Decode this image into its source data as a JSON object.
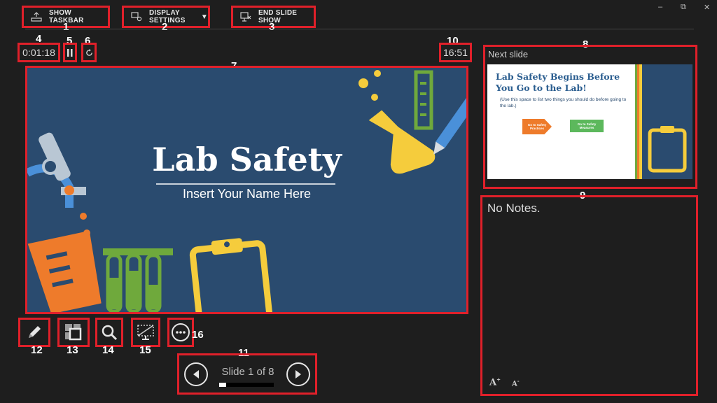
{
  "toolbar": {
    "show_taskbar": "SHOW TASKBAR",
    "display_settings": "DISPLAY SETTINGS",
    "end_slide_show": "END SLIDE SHOW"
  },
  "window_controls": {
    "minimize": "–",
    "restore": "⧉",
    "close": "✕"
  },
  "timer": {
    "elapsed": "0:01:18",
    "pause_icon": "pause-icon",
    "reset_icon": "reset-icon"
  },
  "clock": "16:51",
  "current_slide": {
    "title": "Lab Safety",
    "subtitle": "Insert Your Name Here"
  },
  "next_slide": {
    "label": "Next slide",
    "title": "Lab Safety Begins Before You Go to the Lab!",
    "bullet": "(Use this space to list two things you should do before going to the lab.)",
    "button1": "Go to Safety Practices",
    "button2": "Go to Safety Measures"
  },
  "notes": {
    "text": "No Notes.",
    "increase_font": "A",
    "decrease_font": "A"
  },
  "navigation": {
    "slide_counter": "Slide 1 of 8",
    "progress": 0.125
  },
  "tools": [
    "pen-tool",
    "see-all-slides",
    "zoom",
    "black-screen",
    "more-options"
  ],
  "annotations": [
    "1",
    "2",
    "3",
    "4",
    "5",
    "6",
    "7",
    "8",
    "9",
    "10",
    "11",
    "12",
    "13",
    "14",
    "15",
    "16"
  ],
  "colors": {
    "annotation_box": "#e0202a",
    "slide_bg": "#2a4b6f",
    "accent_yellow": "#f5cc3c",
    "accent_orange": "#ee7b2b",
    "accent_green": "#6fa93c",
    "accent_blue": "#4a90d9"
  }
}
